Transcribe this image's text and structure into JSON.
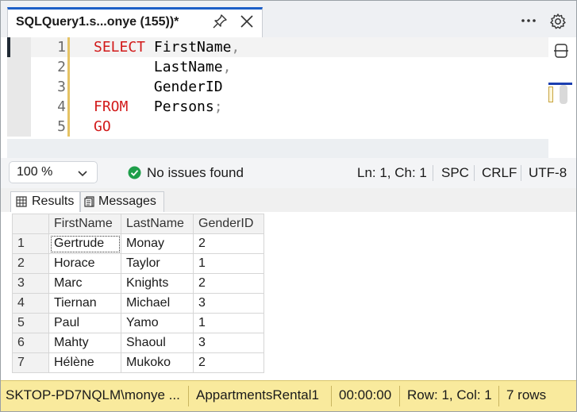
{
  "tab": {
    "title": "SQLQuery1.s...onye (155))*"
  },
  "editor": {
    "lines": [
      {
        "no": "1",
        "parts": [
          {
            "t": "SELECT",
            "k": "kw"
          },
          {
            "t": " FirstName",
            "k": ""
          },
          {
            "t": ",",
            "k": "pn"
          }
        ]
      },
      {
        "no": "2",
        "parts": [
          {
            "t": "       LastName",
            "k": ""
          },
          {
            "t": ",",
            "k": "pn"
          }
        ]
      },
      {
        "no": "3",
        "parts": [
          {
            "t": "       GenderID",
            "k": ""
          }
        ]
      },
      {
        "no": "4",
        "parts": [
          {
            "t": "FROM",
            "k": "kw"
          },
          {
            "t": "   Persons",
            "k": ""
          },
          {
            "t": ";",
            "k": "pn"
          }
        ]
      },
      {
        "no": "5",
        "parts": [
          {
            "t": "GO",
            "k": "kw"
          }
        ]
      }
    ]
  },
  "status_row": {
    "zoom": "100 %",
    "issues": "No issues found",
    "position": "Ln: 1, Ch: 1",
    "whitespace": "SPC",
    "line_ending": "CRLF",
    "encoding": "UTF-8"
  },
  "result_tabs": {
    "results": "Results",
    "messages": "Messages"
  },
  "grid": {
    "columns": [
      "FirstName",
      "LastName",
      "GenderID"
    ],
    "rows": [
      [
        "1",
        "Gertrude",
        "Monay",
        "2"
      ],
      [
        "2",
        "Horace",
        "Taylor",
        "1"
      ],
      [
        "3",
        "Marc",
        "Knights",
        "2"
      ],
      [
        "4",
        "Tiernan",
        "Michael",
        "3"
      ],
      [
        "5",
        "Paul",
        "Yamo",
        "1"
      ],
      [
        "6",
        "Mahty",
        "Shaoul",
        "3"
      ],
      [
        "7",
        "Hélène",
        "Mukoko",
        "2"
      ]
    ]
  },
  "statusbar": {
    "connection": "SKTOP-PD7NQLM\\monye ...",
    "database": "AppartmentsRental1",
    "elapsed": "00:00:00",
    "rowcol": "Row: 1, Col: 1",
    "rowcount": "7 rows"
  },
  "colors": {
    "accent": "#1c5fc7",
    "keyword": "#d21a1a",
    "success": "#1e9e4a",
    "statusbar": "#f9ea9d"
  },
  "icons": [
    "pin-icon",
    "close-icon",
    "more-icon",
    "gear-icon",
    "split-editor-icon",
    "chevron-down-icon",
    "check-circle-icon",
    "grid-icon",
    "messages-icon"
  ]
}
